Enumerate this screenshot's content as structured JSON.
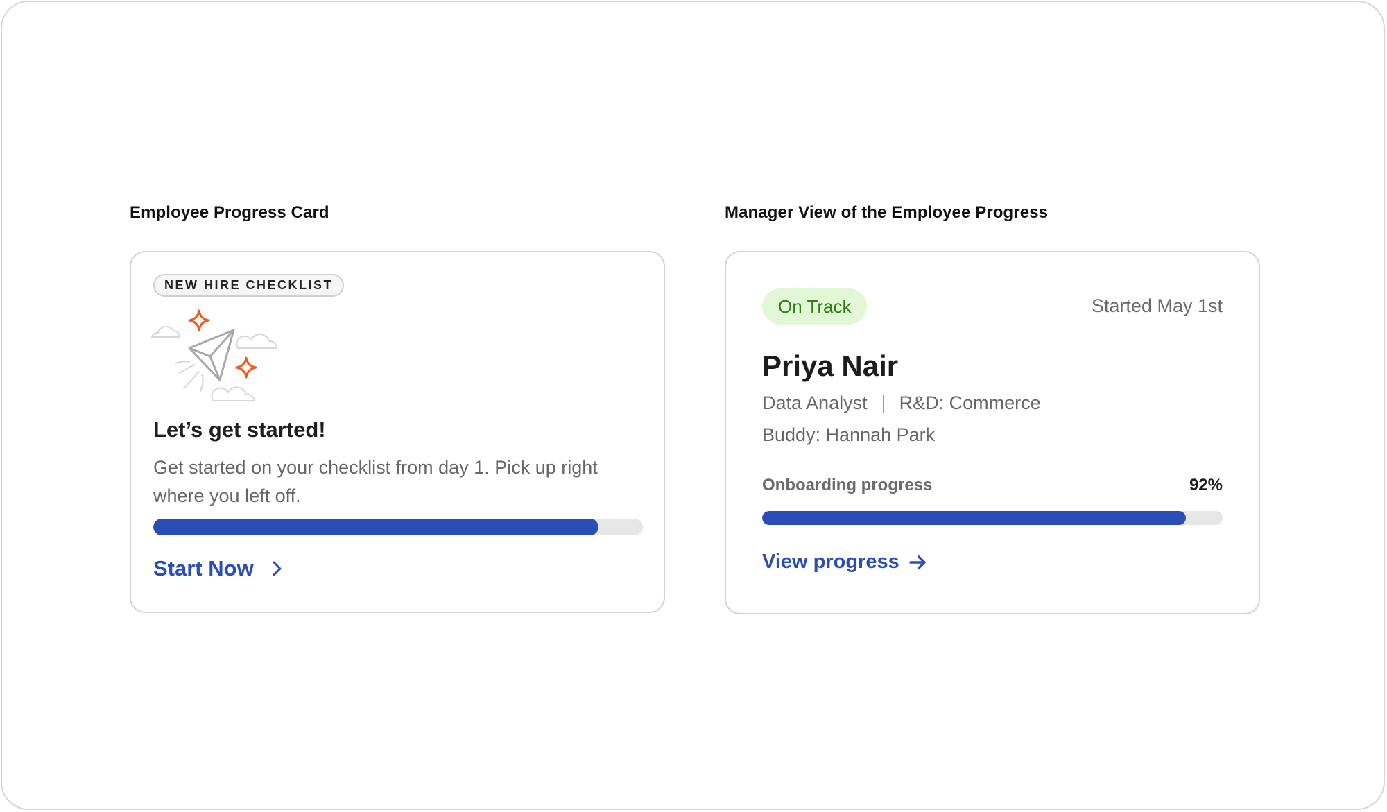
{
  "employee_section": {
    "title": "Employee Progress Card",
    "chip": "NEW HIRE CHECKLIST",
    "illustration_icon": "paper-plane-icon",
    "heading": "Let’s get started!",
    "body": "Get started on your checklist from day 1. Pick up right where you left off.",
    "progress": 0.91,
    "cta": "Start Now"
  },
  "manager_section": {
    "title": "Manager View of the Employee Progress",
    "status": "On Track",
    "started": "Started May 1st",
    "name": "Priya Nair",
    "role": "Data Analyst",
    "department": "R&D: Commerce",
    "buddy": "Buddy: Hannah Park",
    "progress_label": "Onboarding progress",
    "progress_pct": "92%",
    "progress": 0.92,
    "cta": "View progress"
  },
  "colors": {
    "accent": "#2a4db8",
    "spark": "#f05a1e",
    "status_bg": "#e2f7d6",
    "status_text": "#2f7d14"
  }
}
